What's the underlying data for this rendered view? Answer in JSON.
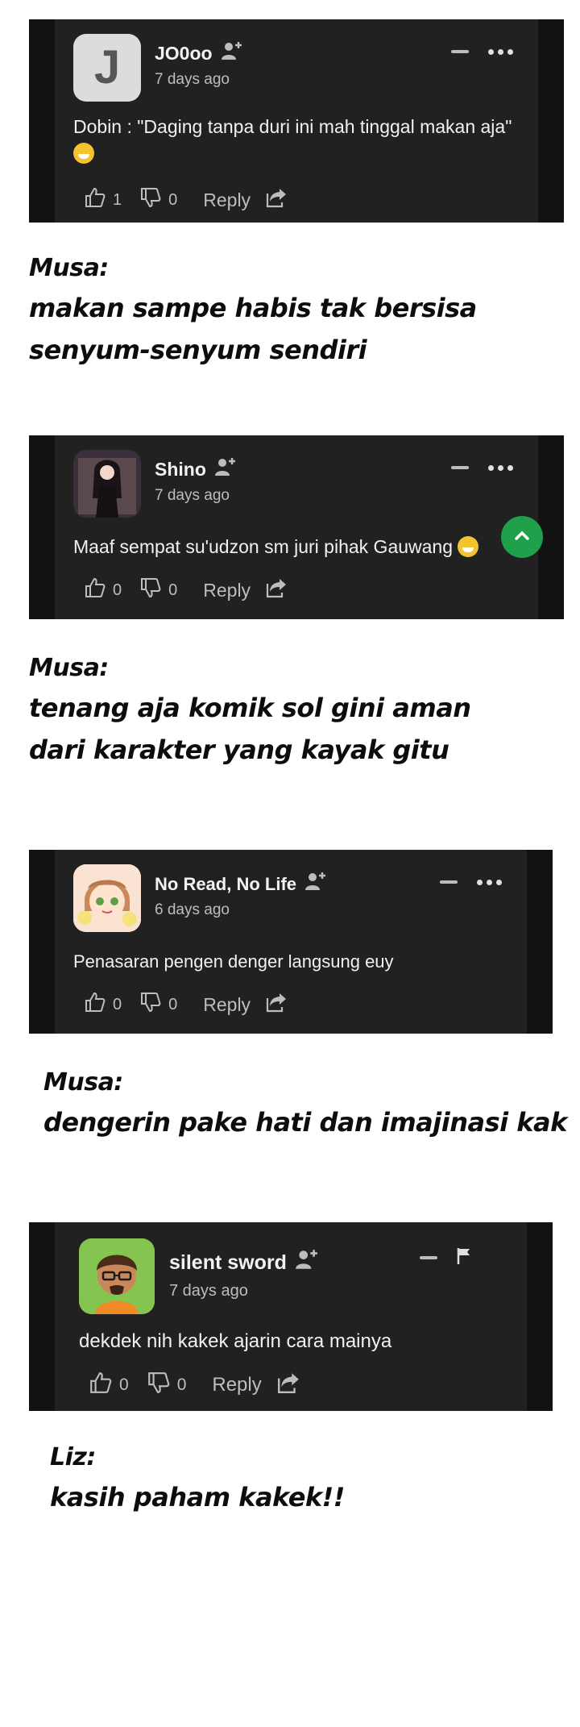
{
  "comments": [
    {
      "avatar_letter": "J",
      "username": "JO0oo",
      "time": "7 days ago",
      "text": "Dobin : \"Daging tanpa duri ini mah tinggal makan aja\"",
      "likes": "1",
      "dislikes": "0",
      "reply_label": "Reply"
    },
    {
      "username": "Shino",
      "time": "7 days ago",
      "text": "Maaf sempat su'udzon sm juri pihak Gauwang",
      "likes": "0",
      "dislikes": "0",
      "reply_label": "Reply"
    },
    {
      "username": "No Read, No Life",
      "time": "6 days ago",
      "text": "Penasaran pengen denger langsung euy",
      "likes": "0",
      "dislikes": "0",
      "reply_label": "Reply"
    },
    {
      "username": "silent sword",
      "time": "7 days ago",
      "text": "dekdek nih kakek ajarin cara mainya",
      "likes": "0",
      "dislikes": "0",
      "reply_label": "Reply"
    }
  ],
  "captions": [
    {
      "name": "Musa:",
      "lines": [
        "makan sampe habis tak bersisa",
        "senyum-senyum sendiri"
      ]
    },
    {
      "name": "Musa:",
      "lines": [
        "tenang aja komik sol gini aman",
        "dari karakter yang kayak gitu"
      ]
    },
    {
      "name": "Musa:",
      "lines": [
        "dengerin pake hati dan imajinasi kak"
      ]
    },
    {
      "name": "Liz:",
      "lines": [
        "kasih paham kakek!!"
      ]
    }
  ],
  "colors": {
    "card_bg": "#212121",
    "card_border": "#121212",
    "scroll_button": "#1ea14a"
  },
  "icons": [
    "follow-icon",
    "minus-icon",
    "more-icon",
    "thumbs-up-icon",
    "thumbs-down-icon",
    "share-icon",
    "flag-icon",
    "chevron-up-icon"
  ]
}
